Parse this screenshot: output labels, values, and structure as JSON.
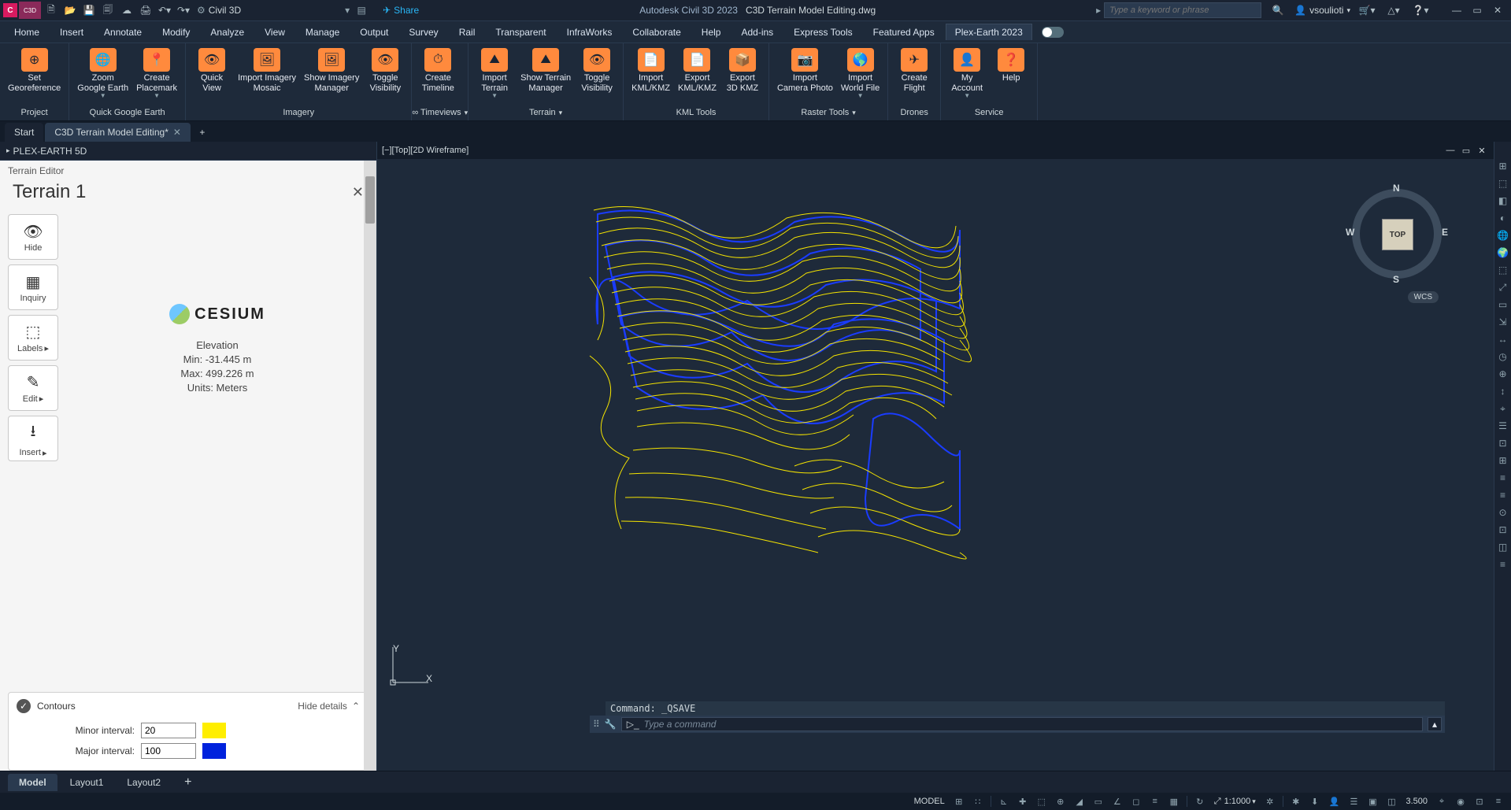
{
  "titlebar": {
    "app_badge": "C3D",
    "workspace": "Civil 3D",
    "share": "Share",
    "product": "Autodesk Civil 3D 2023",
    "filename": "C3D Terrain Model Editing.dwg",
    "search_placeholder": "Type a keyword or phrase",
    "username": "vsoulioti"
  },
  "menus": [
    "Home",
    "Insert",
    "Annotate",
    "Modify",
    "Analyze",
    "View",
    "Manage",
    "Output",
    "Survey",
    "Rail",
    "Transparent",
    "InfraWorks",
    "Collaborate",
    "Help",
    "Add-ins",
    "Express Tools",
    "Featured Apps",
    "Plex-Earth 2023"
  ],
  "active_menu": "Plex-Earth 2023",
  "ribbon": {
    "panels": [
      {
        "title": "Project",
        "buttons": [
          {
            "label": "Set\nGeoreference"
          }
        ]
      },
      {
        "title": "Quick Google Earth",
        "buttons": [
          {
            "label": "Zoom\nGoogle Earth",
            "caret": true
          },
          {
            "label": "Create\nPlacemark",
            "caret": true
          }
        ]
      },
      {
        "title": "Imagery",
        "buttons": [
          {
            "label": "Quick\nView"
          },
          {
            "label": "Import Imagery\nMosaic"
          },
          {
            "label": "Show Imagery\nManager"
          },
          {
            "label": "Toggle\nVisibility"
          }
        ]
      },
      {
        "title": "∞ Timeviews",
        "caret": true,
        "buttons": [
          {
            "label": "Create\nTimeline"
          }
        ]
      },
      {
        "title": "Terrain",
        "caret": true,
        "buttons": [
          {
            "label": "Import\nTerrain",
            "caret": true
          },
          {
            "label": "Show Terrain\nManager"
          },
          {
            "label": "Toggle\nVisibility"
          }
        ]
      },
      {
        "title": "KML Tools",
        "buttons": [
          {
            "label": "Import\nKML/KMZ"
          },
          {
            "label": "Export\nKML/KMZ"
          },
          {
            "label": "Export\n3D KMZ"
          }
        ]
      },
      {
        "title": "Raster Tools",
        "caret": true,
        "buttons": [
          {
            "label": "Import\nCamera Photo"
          },
          {
            "label": "Import\nWorld File",
            "caret": true
          }
        ]
      },
      {
        "title": "Drones",
        "buttons": [
          {
            "label": "Create\nFlight"
          }
        ]
      },
      {
        "title": "Service",
        "buttons": [
          {
            "label": "My\nAccount",
            "caret": true
          },
          {
            "label": "Help"
          }
        ]
      }
    ]
  },
  "doctabs": {
    "tabs": [
      {
        "label": "Start",
        "closable": false
      },
      {
        "label": "C3D Terrain Model Editing*",
        "closable": true
      }
    ],
    "active": 1
  },
  "palette": {
    "title": "PLEX-EARTH 5D",
    "editor_header": "Terrain Editor",
    "terrain_name": "Terrain 1",
    "tools": [
      {
        "icon": "👁",
        "label": "Hide"
      },
      {
        "icon": "▦",
        "label": "Inquiry"
      },
      {
        "icon": "⬚",
        "label": "Labels",
        "caret": true
      },
      {
        "icon": "✎",
        "label": "Edit",
        "caret": true
      },
      {
        "icon": "⭳",
        "label": "Insert",
        "caret": true
      }
    ],
    "provider": "CESIUM",
    "elev_title": "Elevation",
    "elev_min": "Min: -31.445 m",
    "elev_max": "Max: 499.226 m",
    "elev_units": "Units: Meters",
    "contours_label": "Contours",
    "hide_details": "Hide details",
    "minor_label": "Minor interval:",
    "minor_value": "20",
    "major_label": "Major interval:",
    "major_value": "100"
  },
  "viewport": {
    "label": "[−][Top][2D Wireframe]",
    "compass": {
      "N": "N",
      "S": "S",
      "E": "E",
      "W": "W",
      "face": "TOP"
    },
    "wcs": "WCS",
    "ucs": {
      "x": "X",
      "y": "Y"
    },
    "cmd_history": "Command: _QSAVE",
    "cmd_placeholder": "Type a command"
  },
  "layout_tabs": [
    "Model",
    "Layout1",
    "Layout2"
  ],
  "layout_active": 0,
  "status": {
    "model": "MODEL",
    "scale": "1:1000",
    "decimal": "3.500"
  }
}
